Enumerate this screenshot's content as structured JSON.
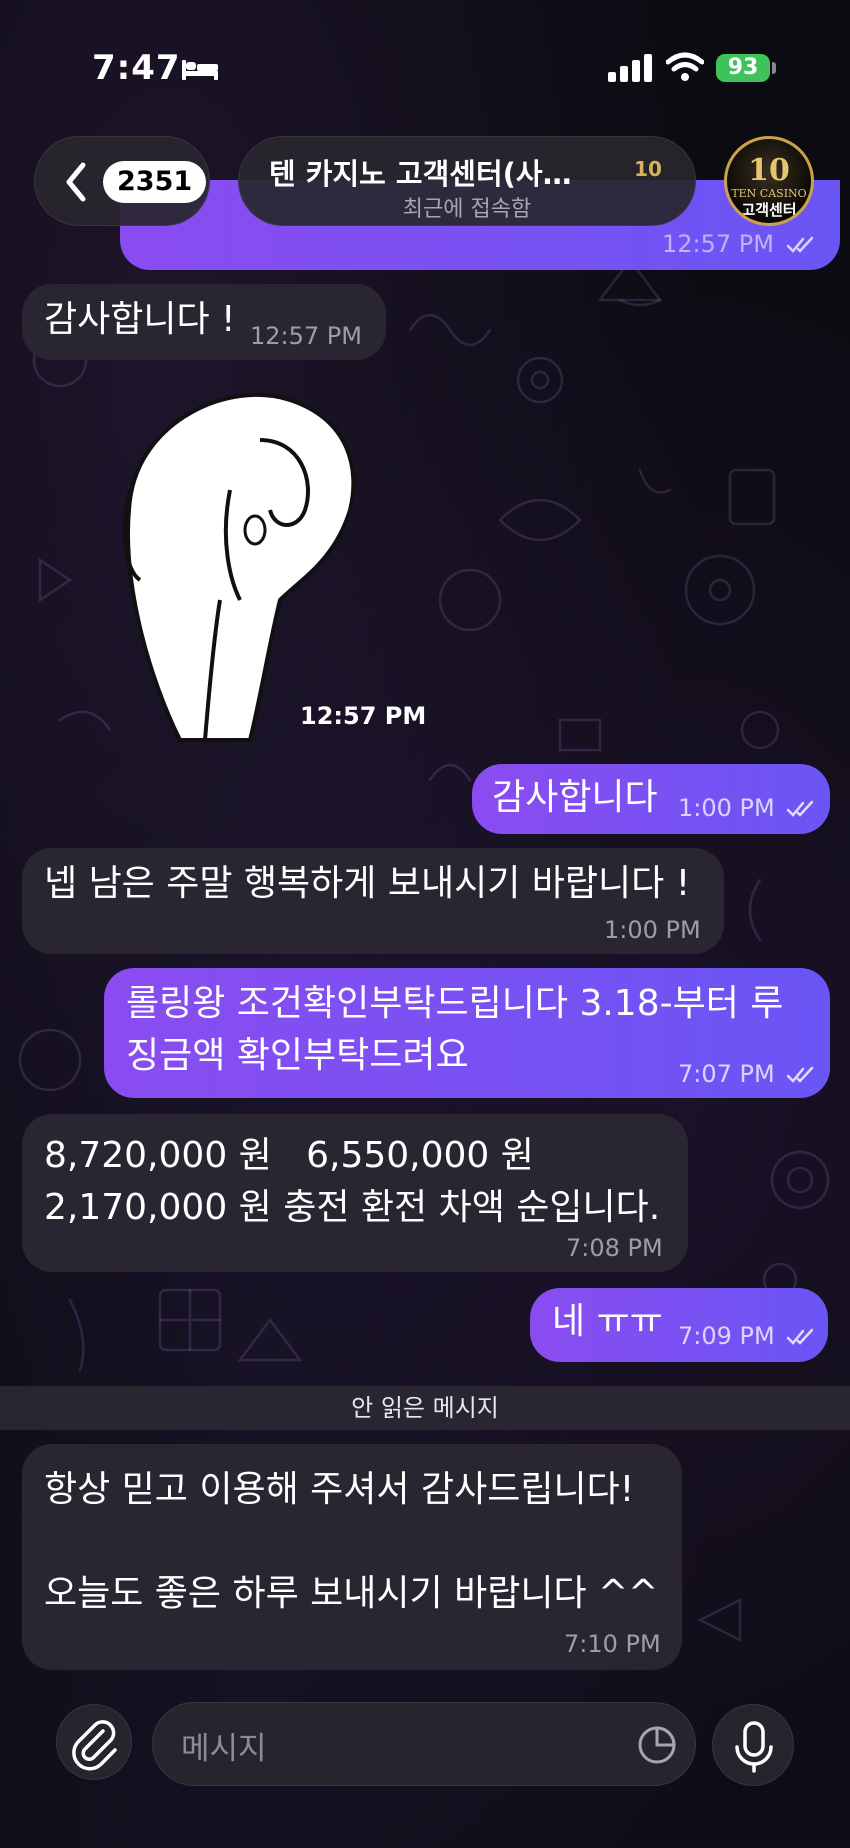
{
  "status_bar": {
    "time": "7:47",
    "battery": "93"
  },
  "header": {
    "back_count": "2351",
    "chat_title": "텐 카지노 고객센터(사…",
    "title_badge": "10",
    "subtitle": "최근에 접속함",
    "avatar": {
      "logo": "10",
      "brand": "TEN CASINO",
      "sub": "고객센터"
    }
  },
  "messages": [
    {
      "dir": "out",
      "text": "",
      "time": "12:57 PM",
      "read": true
    },
    {
      "dir": "in",
      "text": "감사합니다 !",
      "time": "12:57 PM"
    },
    {
      "dir": "in",
      "type": "sticker",
      "sticker": "bowing-character-sticker",
      "time": "12:57 PM"
    },
    {
      "dir": "out",
      "text": "감사합니다",
      "time": "1:00 PM",
      "read": true
    },
    {
      "dir": "in",
      "text": "넵 남은 주말 행복하게 보내시기 바랍니다 !",
      "time": "1:00 PM"
    },
    {
      "dir": "out",
      "text": "롤링왕 조건확인부탁드립니다 3.18-부터 루\n징금액 확인부탁드려요",
      "time": "7:07 PM",
      "read": true
    },
    {
      "dir": "in",
      "text": "8,720,000 원   6,550,000 원\n2,170,000 원 충전 환전 차액 순입니다.",
      "time": "7:08 PM"
    },
    {
      "dir": "out",
      "text": "네 ㅠㅠ",
      "time": "7:09 PM",
      "read": true
    },
    {
      "dir": "in",
      "text": "항상 믿고 이용해 주셔서 감사드립니다!\n\n오늘도 좋은 하루 보내시기 바랍니다 ^^",
      "time": "7:10 PM"
    }
  ],
  "unread_divider": "안 읽은 메시지",
  "composer": {
    "placeholder": "메시지"
  },
  "colors": {
    "outgoing_bubble_start": "#8a4cf0",
    "outgoing_bubble_end": "#6a55f5",
    "incoming_bubble": "#2b2832",
    "battery": "#3ec25a"
  }
}
